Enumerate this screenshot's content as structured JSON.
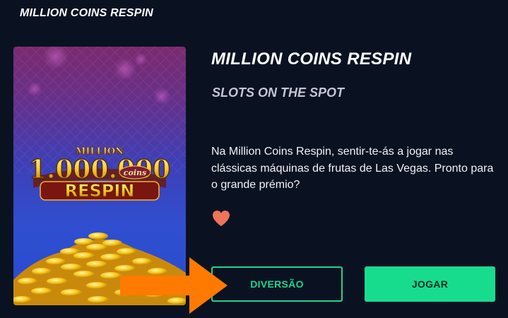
{
  "header": {
    "title": "MILLION COINS RESPIN"
  },
  "game": {
    "title": "MILLION COINS RESPIN",
    "provider": "SLOTS ON THE SPOT",
    "description": "Na Million Coins Respin, sentir-te-ás a jogar nas clássicas máquinas de frutas de Las Vegas. Pronto para o grande prémio?",
    "logo": {
      "line1": "MILLION",
      "line2": "1.000.000",
      "line3": "coins",
      "line4": "RESPIN"
    }
  },
  "actions": {
    "fun_label": "DIVERSÃO",
    "play_label": "JOGAR"
  },
  "icons": {
    "favorite": "heart-icon",
    "pointer": "arrow-right-icon"
  },
  "colors": {
    "background": "#0a1222",
    "accent_green": "#17dc8e",
    "heart": "#f0735a",
    "arrow": "#ff7a00"
  }
}
